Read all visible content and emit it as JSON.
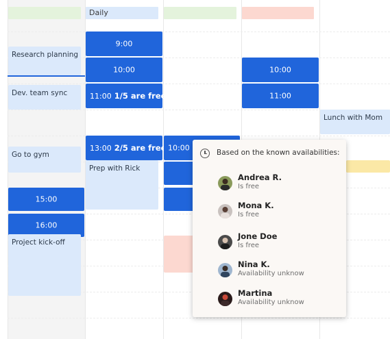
{
  "header": {
    "daily_label": "Daily"
  },
  "events": {
    "research_planning": "Research planning",
    "dev_team_sync": "Dev. team sync",
    "go_to_gym": "Go to gym",
    "project_kickoff": "Project kick-off",
    "prep_with_rick": "Prep with Rick",
    "lunch_with_mom": "Lunch with Mom"
  },
  "slots": {
    "col1_900": "9:00",
    "col1_1000": "10:00",
    "col1_1100_time": "11:00",
    "col1_1100_free": "1/5 are free",
    "col1_1300_time": "13:00",
    "col1_1300_free": "2/5 are free",
    "col2_1000": "10:00",
    "col3_1000": "10:00",
    "col3_1100": "11:00",
    "col0_1500": "15:00",
    "col0_1600": "16:00"
  },
  "popover": {
    "heading": "Based on the known availabilities:",
    "people": [
      {
        "name": "Andrea R.",
        "status": "Is free"
      },
      {
        "name": "Mona K.",
        "status": "Is free"
      },
      {
        "name": "Jone Doe",
        "status": "Is free"
      },
      {
        "name": "Nina K.",
        "status": "Availability unknow"
      },
      {
        "name": "Martina",
        "status": "Availability unknow"
      }
    ]
  },
  "colors": {
    "slot_blue": "#2065db",
    "event_light_blue": "#dbe9fb",
    "event_pink": "#fcd8d0",
    "event_yellow": "#fbe8a6",
    "event_green": "#e4f3dc",
    "popover_bg": "#fbf8f5"
  }
}
